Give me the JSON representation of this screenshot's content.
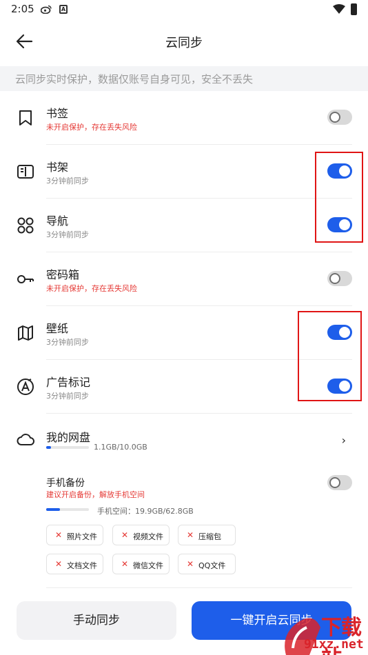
{
  "status_bar": {
    "time": "2:05",
    "a_icon": "A"
  },
  "header": {
    "title": "云同步"
  },
  "banner": {
    "text": "云同步实时保护，数据仅账号自身可见，安全不丢失"
  },
  "rows": [
    {
      "title": "书签",
      "subtitle": "未开启保护，存在丢失风险",
      "enabled": false,
      "icon": "bookmark-icon"
    },
    {
      "title": "书架",
      "subtitle": "3分钟前同步",
      "enabled": true,
      "icon": "book-icon"
    },
    {
      "title": "导航",
      "subtitle": "3分钟前同步",
      "enabled": true,
      "icon": "grid-circles-icon"
    },
    {
      "title": "密码箱",
      "subtitle": "未开启保护，存在丢失风险",
      "enabled": false,
      "icon": "key-icon"
    },
    {
      "title": "壁纸",
      "subtitle": "3分钟前同步",
      "enabled": true,
      "icon": "map-icon"
    },
    {
      "title": "广告标记",
      "subtitle": "3分钟前同步",
      "enabled": true,
      "icon": "ad-mark-icon"
    }
  ],
  "drive": {
    "title": "我的网盘",
    "size": "1.1GB/10.0GB",
    "used_fraction": 0.11
  },
  "backup": {
    "title": "手机备份",
    "subtitle": "建议开启备份，解放手机空间",
    "space": "手机空间：19.9GB/62.8GB",
    "used_fraction": 0.32,
    "enabled": false,
    "chips": [
      "照片文件",
      "视频文件",
      "压缩包",
      "文档文件",
      "微信文件",
      "QQ文件"
    ]
  },
  "buttons": {
    "manual": "手动同步",
    "primary": "一键开启云同步"
  },
  "watermark": {
    "line1": "下载站",
    "line2": "91xz.net"
  },
  "colors": {
    "accent": "#1e5eea",
    "warning": "#e53935",
    "highlight": "#e01414"
  }
}
